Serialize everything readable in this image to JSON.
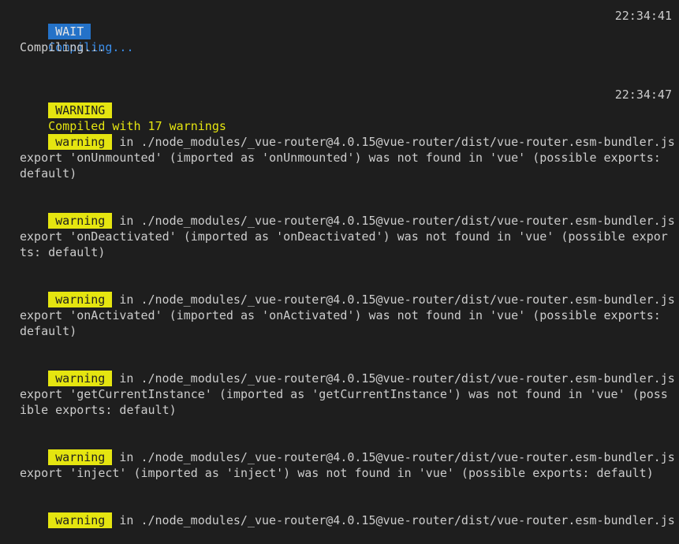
{
  "header": {
    "wait_tag": "WAIT",
    "wait_text": "Compiling...",
    "wait_time": "22:34:41",
    "compiling": "Compiling...",
    "warning_tag": "WARNING",
    "warning_text": "Compiled with 17 warnings",
    "warning_time": "22:34:47"
  },
  "colors": {
    "background": "#1e1e1e",
    "wait_badge": "#2472c8",
    "wait_text": "#3b8eea",
    "warning_badge": "#e5e510"
  },
  "warnings": [
    {
      "tag": "warning",
      "location": " in ./node_modules/_vue-router@4.0.15@vue-router/dist/vue-router.esm-bundler.js",
      "message": "export 'onUnmounted' (imported as 'onUnmounted') was not found in 'vue' (possible exports: default)"
    },
    {
      "tag": "warning",
      "location": " in ./node_modules/_vue-router@4.0.15@vue-router/dist/vue-router.esm-bundler.js",
      "message": "export 'onDeactivated' (imported as 'onDeactivated') was not found in 'vue' (possible exports: default)"
    },
    {
      "tag": "warning",
      "location": " in ./node_modules/_vue-router@4.0.15@vue-router/dist/vue-router.esm-bundler.js",
      "message": "export 'onActivated' (imported as 'onActivated') was not found in 'vue' (possible exports: default)"
    },
    {
      "tag": "warning",
      "location": " in ./node_modules/_vue-router@4.0.15@vue-router/dist/vue-router.esm-bundler.js",
      "message": "export 'getCurrentInstance' (imported as 'getCurrentInstance') was not found in 'vue' (possible exports: default)"
    },
    {
      "tag": "warning",
      "location": " in ./node_modules/_vue-router@4.0.15@vue-router/dist/vue-router.esm-bundler.js",
      "message": "export 'inject' (imported as 'inject') was not found in 'vue' (possible exports: default)"
    },
    {
      "tag": "warning",
      "location": " in ./node_modules/_vue-router@4.0.15@vue-router/dist/vue-router.esm-bundler.js",
      "message": ""
    }
  ]
}
